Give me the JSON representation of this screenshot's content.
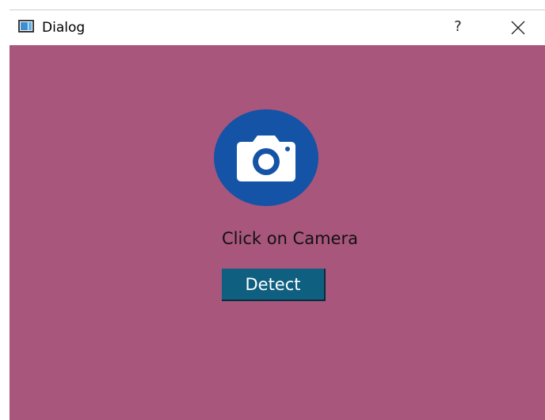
{
  "window": {
    "title": "Dialog",
    "help_label": "?",
    "close_icon": "close-icon",
    "app_icon": "window-app-icon"
  },
  "main": {
    "background_color": "#a8567c",
    "camera": {
      "icon": "camera-icon",
      "circle_color": "#1553a6"
    },
    "hint_text": "Click on Camera",
    "detect_label": "Detect",
    "detect_color": "#0e5f80"
  }
}
